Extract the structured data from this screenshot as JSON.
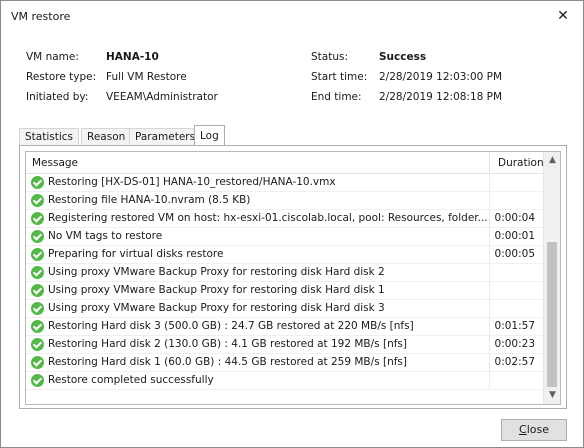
{
  "window": {
    "title": "VM restore",
    "close_glyph": "✕"
  },
  "info": {
    "vm_name_label": "VM name:",
    "vm_name": "HANA-10",
    "restore_type_label": "Restore type:",
    "restore_type": "Full VM Restore",
    "initiated_by_label": "Initiated by:",
    "initiated_by": "VEEAM\\Administrator",
    "status_label": "Status:",
    "status": "Success",
    "start_time_label": "Start time:",
    "start_time": "2/28/2019 12:03:00 PM",
    "end_time_label": "End time:",
    "end_time": "2/28/2019 12:08:18 PM"
  },
  "tabs": [
    {
      "label": "Statistics"
    },
    {
      "label": "Reason"
    },
    {
      "label": "Parameters"
    },
    {
      "label": "Log",
      "active": true
    }
  ],
  "log": {
    "col_message": "Message",
    "col_duration": "Duration",
    "rows": [
      {
        "message": "Restoring [HX-DS-01] HANA-10_restored/HANA-10.vmx",
        "duration": ""
      },
      {
        "message": "Restoring file HANA-10.nvram (8.5 KB)",
        "duration": ""
      },
      {
        "message": "Registering restored VM on host: hx-esxi-01.ciscolab.local, pool: Resources, folder...",
        "duration": "0:00:04"
      },
      {
        "message": "No VM tags to restore",
        "duration": "0:00:01"
      },
      {
        "message": "Preparing for virtual disks restore",
        "duration": "0:00:05"
      },
      {
        "message": "Using proxy VMware Backup Proxy for restoring disk Hard disk 2",
        "duration": ""
      },
      {
        "message": "Using proxy VMware Backup Proxy for restoring disk Hard disk 1",
        "duration": ""
      },
      {
        "message": "Using proxy VMware Backup Proxy for restoring disk Hard disk 3",
        "duration": ""
      },
      {
        "message": "Restoring Hard disk 3 (500.0 GB) : 24.7 GB restored at 220 MB/s  [nfs]",
        "duration": "0:01:57"
      },
      {
        "message": "Restoring Hard disk 2 (130.0 GB) : 4.1 GB restored at 192 MB/s  [nfs]",
        "duration": "0:00:23"
      },
      {
        "message": "Restoring Hard disk 1 (60.0 GB) : 44.5 GB restored at 259 MB/s  [nfs]",
        "duration": "0:02:57"
      },
      {
        "message": "Restore completed successfully",
        "duration": ""
      }
    ]
  },
  "status_icon": "success-check-icon",
  "status_color": "#53b848",
  "footer": {
    "close_label_underlined": "C",
    "close_label_rest": "lose"
  }
}
